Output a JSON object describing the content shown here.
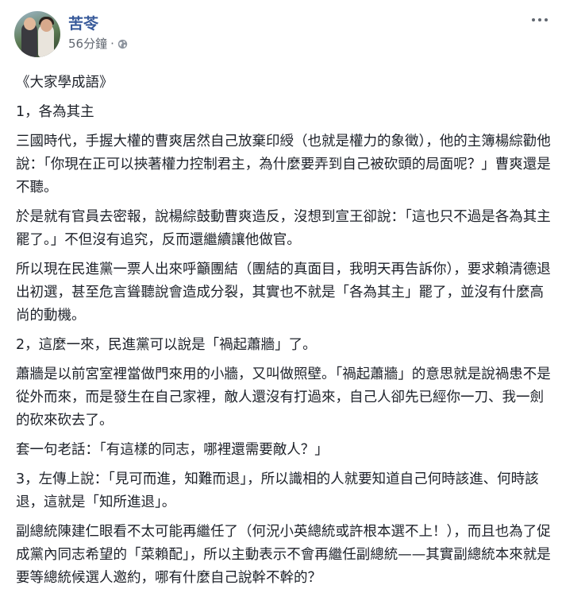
{
  "post": {
    "author": "苦苓",
    "time": "56分鐘",
    "separator": "·",
    "privacy_icon": "globe-icon",
    "more_icon": "more-options-icon",
    "paragraphs": [
      "《大家學成語》",
      "1，各為其主",
      "三國時代，手握大權的曹爽居然自己放棄印綬（也就是權力的象徵），他的主簿楊綜勸他說：「你現在正可以挾著權力控制君主，為什麼要弄到自己被砍頭的局面呢？」曹爽還是不聽。",
      "於是就有官員去密報，說楊綜鼓動曹爽造反，沒想到宣王卻說：「這也只不過是各為其主罷了。」不但沒有追究，反而還繼續讓他做官。",
      "所以現在民進黨一票人出來呼籲團結（團結的真面目，我明天再告訴你），要求賴清德退出初選，甚至危言聳聽說會造成分裂，其實也不就是「各為其主」罷了，並沒有什麼高尚的動機。",
      "2，這麼一來，民進黨可以說是「禍起蕭牆」了。",
      "蕭牆是以前宮室裡當做門來用的小牆，又叫做照壁。「禍起蕭牆」的意思就是說禍患不是從外而來，而是發生在自己家裡，敵人還沒有打過來，自己人卻先已經你一刀、我一劍的砍來砍去了。",
      "套一句老話：「有這樣的同志，哪裡還需要敵人？」",
      "3，左傳上說：「見可而進，知難而退」，所以識相的人就要知道自己何時該進、何時該退，這就是「知所進退」。",
      "副總統陳建仁眼看不太可能再繼任了（何況小英總統或許根本選不上！），而且也為了促成黨內同志希望的「菜賴配」，所以主動表示不會再繼任副總統——其實副總統本來就是要等總統候選人邀約，哪有什麼自己說幹不幹的？"
    ]
  }
}
